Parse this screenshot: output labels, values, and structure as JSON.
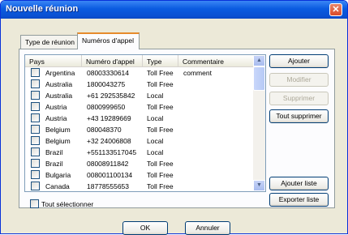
{
  "window": {
    "title": "Nouvelle réunion",
    "close_glyph": "✕"
  },
  "tabs": [
    {
      "label": "Type de réunion",
      "active": false
    },
    {
      "label": "Numéros d'appel",
      "active": true
    }
  ],
  "table": {
    "columns": [
      "Pays",
      "Numéro d'appel",
      "Type",
      "Commentaire"
    ],
    "rows": [
      {
        "country": "Argentina",
        "number": "08003330614",
        "type": "Toll Free",
        "comment": "comment"
      },
      {
        "country": "Australia",
        "number": "1800043275",
        "type": "Toll Free",
        "comment": ""
      },
      {
        "country": "Australia",
        "number": "+61 292535842",
        "type": "Local",
        "comment": ""
      },
      {
        "country": "Austria",
        "number": "0800999650",
        "type": "Toll Free",
        "comment": ""
      },
      {
        "country": "Austria",
        "number": "+43 19289669",
        "type": "Local",
        "comment": ""
      },
      {
        "country": "Belgium",
        "number": "080048370",
        "type": "Toll Free",
        "comment": ""
      },
      {
        "country": "Belgium",
        "number": "+32 24006808",
        "type": "Local",
        "comment": ""
      },
      {
        "country": "Brazil",
        "number": "+551133517045",
        "type": "Local",
        "comment": ""
      },
      {
        "country": "Brazil",
        "number": "08008911842",
        "type": "Toll Free",
        "comment": ""
      },
      {
        "country": "Bulgaria",
        "number": "008001100134",
        "type": "Toll Free",
        "comment": ""
      },
      {
        "country": "Canada",
        "number": "18778555653",
        "type": "Toll Free",
        "comment": ""
      }
    ]
  },
  "buttons": {
    "add": "Ajouter",
    "modify": "Modifier",
    "delete": "Supprimer",
    "delete_all": "Tout supprimer",
    "add_list": "Ajouter liste",
    "export_list": "Exporter liste",
    "ok": "OK",
    "cancel": "Annuler"
  },
  "select_all": {
    "label": "Tout sélectionner"
  },
  "scroll": {
    "up_glyph": "▲",
    "down_glyph": "▼"
  }
}
